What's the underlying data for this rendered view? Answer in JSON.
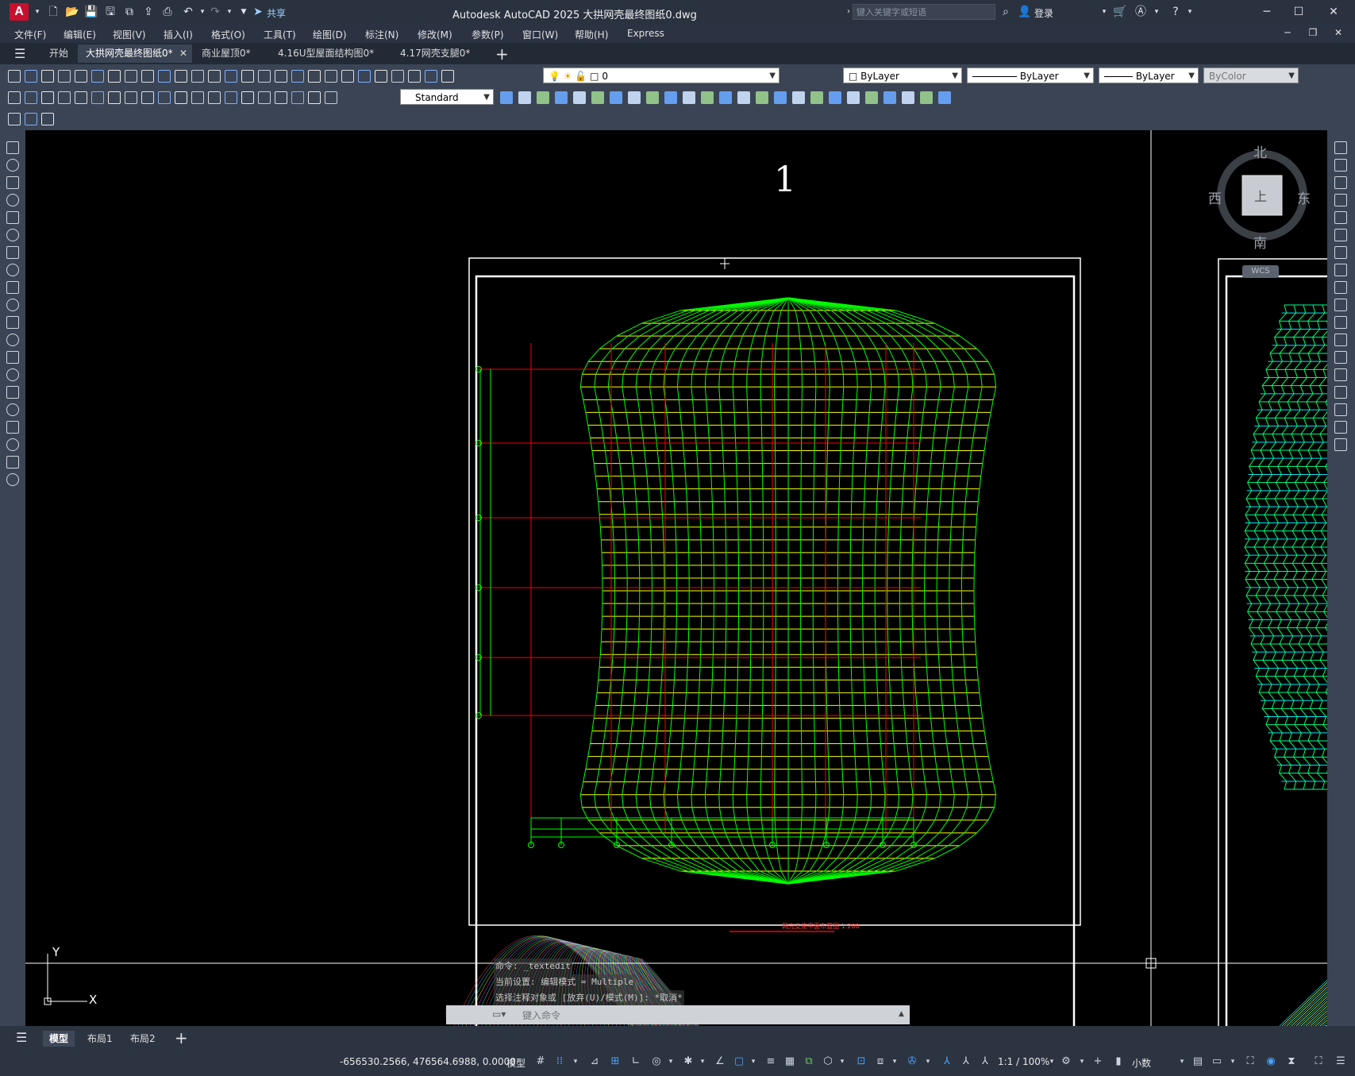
{
  "app": {
    "logo_letter": "A",
    "window_title": "Autodesk AutoCAD 2025    大拱网壳最终图纸0.dwg",
    "share_label": "共享",
    "search_placeholder": "键入关键字或短语",
    "login_label": "登录"
  },
  "menu": [
    "文件(F)",
    "编辑(E)",
    "视图(V)",
    "插入(I)",
    "格式(O)",
    "工具(T)",
    "绘图(D)",
    "标注(N)",
    "修改(M)",
    "参数(P)",
    "窗口(W)",
    "帮助(H)",
    "Express"
  ],
  "tabs": [
    {
      "label": "开始"
    },
    {
      "label": "大拱网壳最终图纸0*",
      "active": true
    },
    {
      "label": "商业屋顶0*"
    },
    {
      "label": "4.16U型屋面结构图0*"
    },
    {
      "label": "4.17网壳支腿0*"
    }
  ],
  "properties": {
    "layer": "0",
    "color": "ByLayer",
    "linetype": "ByLayer",
    "lineweight": "ByLayer",
    "plotstyle": "ByColor",
    "text_style": "Standard"
  },
  "viewcube": {
    "north": "北",
    "south": "南",
    "east": "东",
    "west": "西",
    "top": "上",
    "wcs": "WCS"
  },
  "drawing": {
    "sheet_number": "1",
    "plan_caption": "网壳支座平面布置图 1:200",
    "ucs_y": "Y",
    "ucs_x": "X",
    "colors": {
      "grid_green": "#00ff00",
      "mesh_yellow": "#ffff00",
      "axis_red": "#ff0000",
      "frame_white": "#ffffff"
    }
  },
  "command": {
    "history": [
      "命令: _textedit",
      "当前设置: 编辑模式 = Multiple",
      "选择注释对象或 [放弃(U)/模式(M)]: *取消*"
    ],
    "placeholder": "键入命令"
  },
  "layouts": [
    {
      "label": "模型",
      "active": true
    },
    {
      "label": "布局1"
    },
    {
      "label": "布局2"
    }
  ],
  "status": {
    "coordinates": "-656530.2566, 476564.6988, 0.0000",
    "space": "模型",
    "scale": "1:1 / 100%",
    "units": "小数"
  }
}
